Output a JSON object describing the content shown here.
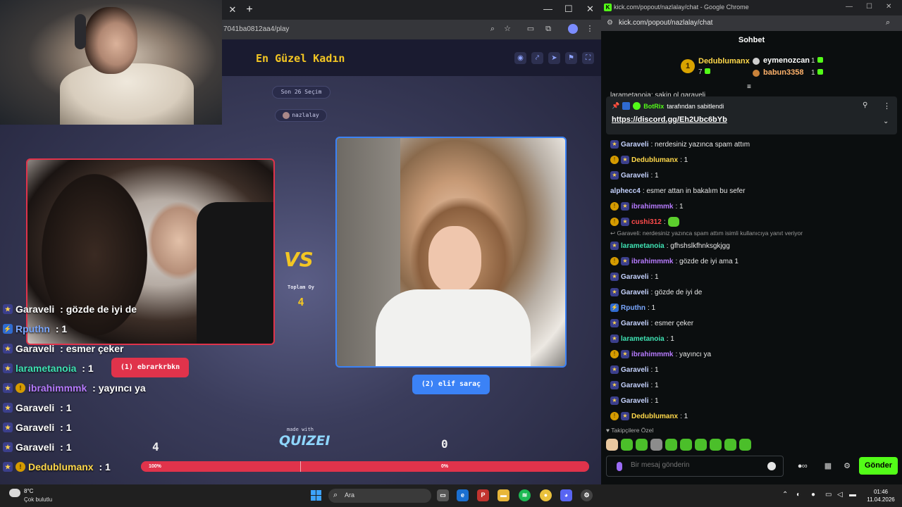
{
  "quiz_browser": {
    "url": "7041ba0812aa4/play",
    "new_tab_glyph": "+",
    "close_tab_glyph": "✕",
    "window_controls": [
      "—",
      "☐",
      "✕"
    ],
    "title": "En Güzel Kadın",
    "round_label": "Son 26 Seçim",
    "host_label": "nazlalay",
    "vs_text": "VS",
    "total_votes_label": "Toplam Oy",
    "total_votes_value": "4",
    "left_choice": {
      "label": "(1) ebrarkrbkn",
      "score": "4",
      "percent": "100%"
    },
    "right_choice": {
      "label": "(2) elif saraç",
      "score": "0",
      "percent": "0%"
    },
    "vote_share_left": 1.0,
    "made_with": "made with",
    "brand": "QUIZEI"
  },
  "overlay_chat": [
    {
      "badges": [
        "star"
      ],
      "user": "Garaveli",
      "color": "#ffffff",
      "text": " : gözde de iyi de"
    },
    {
      "badges": [
        "bot"
      ],
      "user": "Rputhn",
      "color": "#7aa7ff",
      "text": " : 1"
    },
    {
      "badges": [
        "star"
      ],
      "user": "Garaveli",
      "color": "#ffffff",
      "text": " : esmer çeker"
    },
    {
      "badges": [
        "star"
      ],
      "user": "larametanoia",
      "color": "#3fe3b4",
      "text": " : 1"
    },
    {
      "badges": [
        "star",
        "gold"
      ],
      "user": "ibrahimmmk",
      "color": "#b77bff",
      "text": " : yayıncı ya"
    },
    {
      "badges": [
        "star"
      ],
      "user": "Garaveli",
      "color": "#ffffff",
      "text": " : 1"
    },
    {
      "badges": [
        "star"
      ],
      "user": "Garaveli",
      "color": "#ffffff",
      "text": " : 1"
    },
    {
      "badges": [
        "star"
      ],
      "user": "Garaveli",
      "color": "#ffffff",
      "text": " : 1"
    },
    {
      "badges": [
        "star",
        "gold"
      ],
      "user": "Dedublumanx",
      "color": "#ffd84a",
      "text": " : 1"
    }
  ],
  "chat_window": {
    "title": "kick.com/popout/nazlalay/chat - Google Chrome",
    "url": "kick.com/popout/nazlalay/chat",
    "header": "Sohbet",
    "leaderboard": [
      {
        "rank": "1",
        "name": "Dedublumanx",
        "count": "7",
        "color": "#ffd84a"
      },
      {
        "name": "eymenozcan",
        "count": "1",
        "color": "#ffffff"
      },
      {
        "name": "babun3358",
        "count": "1",
        "color": "#ffb26b"
      }
    ],
    "pinned": {
      "by_user": "BotRix",
      "by_suffix": "tarafından sabitlendi",
      "link": "https://discord.gg/Eh2Ubc6bYb"
    },
    "partial_top": "larametanoia: sakin ol garaveli",
    "messages": [
      {
        "badges": [
          "star"
        ],
        "user": "Garaveli",
        "color": "#c6d3ff",
        "text": ": nerdesiniz yazınca spam attım"
      },
      {
        "badges": [
          "gold",
          "star"
        ],
        "user": "Dedublumanx",
        "color": "#ffd84a",
        "text": ": 1"
      },
      {
        "badges": [
          "star"
        ],
        "user": "Garaveli",
        "color": "#c6d3ff",
        "text": ": 1"
      },
      {
        "badges": [],
        "user": "alphecc4",
        "color": "#c6d3ff",
        "text": ": esmer attan in bakalım bu sefer"
      },
      {
        "badges": [
          "gold",
          "star"
        ],
        "user": "ibrahimmmk",
        "color": "#b77bff",
        "text": ": 1"
      },
      {
        "badges": [
          "gold",
          "star"
        ],
        "user": "cushi312",
        "color": "#ff4b4b",
        "text": ":",
        "emote": true
      },
      {
        "reply": "Garaveli: nerdesiniz yazınca spam attım isimli kullanıcıya yanıt veriyor"
      },
      {
        "badges": [
          "star"
        ],
        "user": "larametanoia",
        "color": "#3fe3b4",
        "text": ": gfhshslkfhnksgkjgg"
      },
      {
        "badges": [
          "gold",
          "star"
        ],
        "user": "ibrahimmmk",
        "color": "#b77bff",
        "text": ": gözde de iyi ama 1"
      },
      {
        "badges": [
          "star"
        ],
        "user": "Garaveli",
        "color": "#c6d3ff",
        "text": ": 1"
      },
      {
        "badges": [
          "star"
        ],
        "user": "Garaveli",
        "color": "#c6d3ff",
        "text": ": gözde de iyi de"
      },
      {
        "badges": [
          "bot"
        ],
        "user": "Rputhn",
        "color": "#7aa7ff",
        "text": ": 1"
      },
      {
        "badges": [
          "star"
        ],
        "user": "Garaveli",
        "color": "#c6d3ff",
        "text": ": esmer çeker"
      },
      {
        "badges": [
          "star"
        ],
        "user": "larametanoia",
        "color": "#3fe3b4",
        "text": ": 1"
      },
      {
        "badges": [
          "gold",
          "star"
        ],
        "user": "ibrahimmmk",
        "color": "#b77bff",
        "text": ": yayıncı ya"
      },
      {
        "badges": [
          "star"
        ],
        "user": "Garaveli",
        "color": "#c6d3ff",
        "text": ": 1"
      },
      {
        "badges": [
          "star"
        ],
        "user": "Garaveli",
        "color": "#c6d3ff",
        "text": ": 1"
      },
      {
        "badges": [
          "star"
        ],
        "user": "Garaveli",
        "color": "#c6d3ff",
        "text": ": 1"
      },
      {
        "badges": [
          "gold",
          "star"
        ],
        "user": "Dedublumanx",
        "color": "#ffd84a",
        "text": ": 1"
      }
    ],
    "followers_only": "Takipçilere Özel",
    "input_placeholder": "Bir mesaj gönderin",
    "send_label": "Gönder"
  },
  "taskbar": {
    "temperature": "8°C",
    "weather": "Çok bulutlu",
    "search_placeholder": "Ara",
    "time": "01:46",
    "date": "11.04.2026"
  },
  "colors": {
    "accent_green": "#53fc18",
    "quiz_red": "#e0334b",
    "quiz_blue": "#3b82f6",
    "quiz_gold": "#f3c623"
  }
}
